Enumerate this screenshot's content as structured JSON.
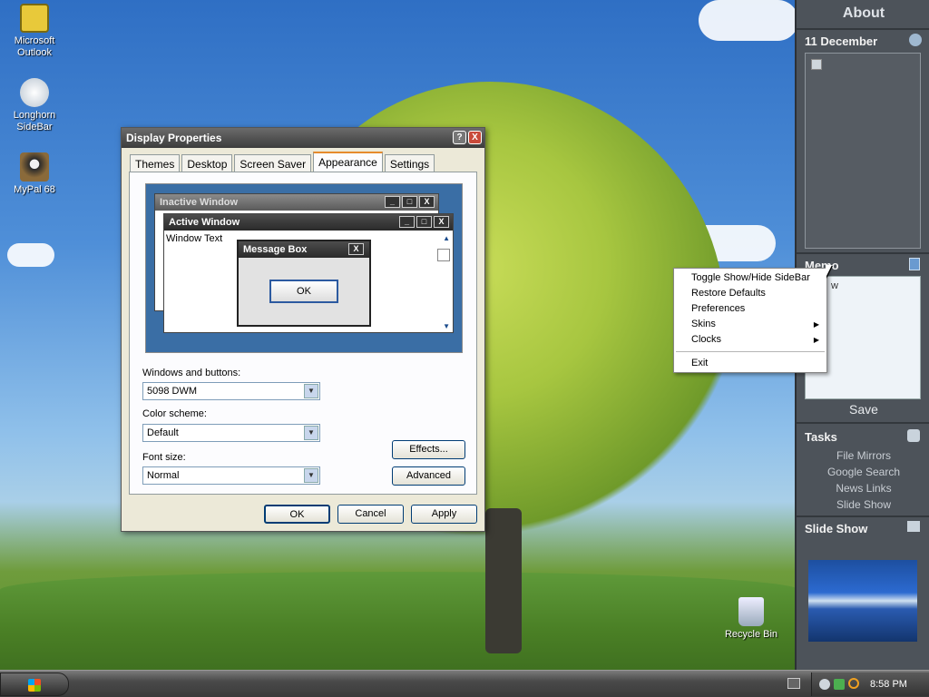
{
  "desktop": {
    "icons": [
      {
        "label_line1": "Microsoft",
        "label_line2": "Outlook",
        "icon": "outlook-icon"
      },
      {
        "label_line1": "Longhorn",
        "label_line2": "SideBar",
        "icon": "longhorn-sidebar-icon"
      },
      {
        "label_line1": "MyPal 68",
        "label_line2": "",
        "icon": "mypal-icon"
      }
    ],
    "recycle_bin": {
      "label": "Recycle Bin",
      "icon": "recycle-bin-icon"
    }
  },
  "dialog": {
    "title": "Display Properties",
    "help_glyph": "?",
    "close_glyph": "X",
    "tabs": [
      "Themes",
      "Desktop",
      "Screen Saver",
      "Appearance",
      "Settings"
    ],
    "active_tab": "Appearance",
    "preview": {
      "inactive_title": "Inactive Window",
      "active_title": "Active Window",
      "window_text": "Window Text",
      "msgbox_title": "Message Box",
      "msgbox_ok": "OK",
      "close_glyph": "X"
    },
    "windows_buttons_label": "Windows and buttons:",
    "windows_buttons_value": "5098 DWM",
    "color_scheme_label": "Color scheme:",
    "color_scheme_value": "Default",
    "font_size_label": "Font size:",
    "font_size_value": "Normal",
    "effects_button": "Effects...",
    "advanced_button": "Advanced",
    "ok_button": "OK",
    "cancel_button": "Cancel",
    "apply_button": "Apply"
  },
  "sidebar": {
    "about": "About",
    "date": "11 December",
    "memo": "Memo",
    "memo_text": "w",
    "save": "Save",
    "tasks": "Tasks",
    "task_links": [
      "File Mirrors",
      "Google Search",
      "News Links",
      "Slide Show"
    ],
    "slide_show": "Slide Show"
  },
  "context_menu": {
    "items": [
      "Toggle Show/Hide SideBar",
      "Restore Defaults",
      "Preferences",
      "Skins",
      "Clocks"
    ],
    "exit": "Exit",
    "submenu_glyph": "▶"
  },
  "taskbar": {
    "clock": "8:58 PM"
  },
  "colors": {
    "sidebar_bg": "#4d535a",
    "title_bar": "#3c3c3c",
    "tab_accent": "#e68b2c"
  }
}
